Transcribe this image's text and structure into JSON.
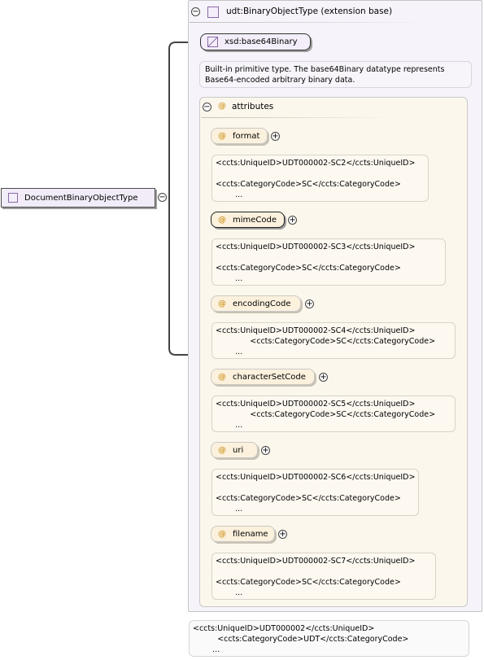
{
  "element": {
    "name": "DocumentBinaryObjectType"
  },
  "type_panel": {
    "title": "udt:BinaryObjectType (extension base)",
    "base": "xsd:base64Binary",
    "base_doc": "Built-in primitive type. The base64Binary datatype represents\nBase64-encoded arbitrary binary data."
  },
  "attributes_group": {
    "title": "attributes",
    "items": [
      {
        "name": "format",
        "annotation": "<ccts:UniqueID>UDT000002-SC2</ccts:UniqueID>\n\n<ccts:CategoryCode>SC</ccts:CategoryCode>\n        ..."
      },
      {
        "name": "mimeCode",
        "annotation": "<ccts:UniqueID>UDT000002-SC3</ccts:UniqueID>\n\n<ccts:CategoryCode>SC</ccts:CategoryCode>\n        ..."
      },
      {
        "name": "encodingCode",
        "annotation": "<ccts:UniqueID>UDT000002-SC4</ccts:UniqueID>\n              <ccts:CategoryCode>SC</ccts:CategoryCode>\n        ..."
      },
      {
        "name": "characterSetCode",
        "annotation": "<ccts:UniqueID>UDT000002-SC5</ccts:UniqueID>\n              <ccts:CategoryCode>SC</ccts:CategoryCode>\n        ..."
      },
      {
        "name": "uri",
        "annotation": "<ccts:UniqueID>UDT000002-SC6</ccts:UniqueID>\n\n<ccts:CategoryCode>SC</ccts:CategoryCode>\n        ..."
      },
      {
        "name": "filename",
        "annotation": "<ccts:UniqueID>UDT000002-SC7</ccts:UniqueID>\n\n<ccts:CategoryCode>SC</ccts:CategoryCode>\n        ..."
      }
    ]
  },
  "footer_annotation": "<ccts:UniqueID>UDT000002</ccts:UniqueID>\n          <ccts:CategoryCode>UDT</ccts:CategoryCode>\n        ...",
  "icons": {
    "element": "complex-type-icon",
    "type": "complex-type-icon",
    "base": "simple-type-icon",
    "attribute": "attribute-icon",
    "collapse": "minus-circle-icon",
    "expand": "plus-circle-icon"
  }
}
